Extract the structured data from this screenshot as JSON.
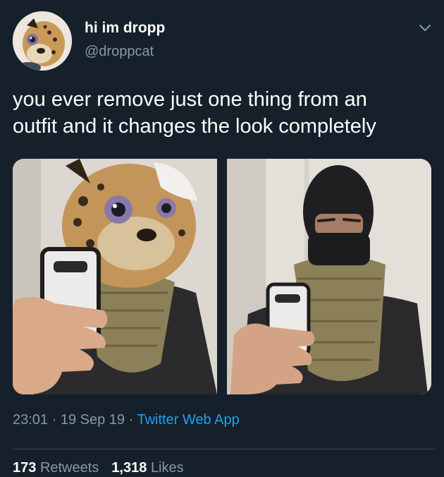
{
  "user": {
    "display_name": "hi im dropp",
    "handle": "@droppcat"
  },
  "tweet": {
    "text": "you ever remove just one thing from an\noutfit and it changes the look completely",
    "time": "23:01",
    "separator": " · ",
    "date": "19 Sep 19",
    "source": "Twitter Web App"
  },
  "stats": {
    "retweets_count": "173",
    "retweets_label": "Retweets",
    "likes_count": "1,318",
    "likes_label": "Likes"
  },
  "icons": {
    "menu": "chevron-down-icon"
  },
  "colors": {
    "background": "#15202b",
    "text_primary": "#ffffff",
    "text_secondary": "#8899a6",
    "link": "#1da1f2",
    "divider": "#38444d"
  }
}
